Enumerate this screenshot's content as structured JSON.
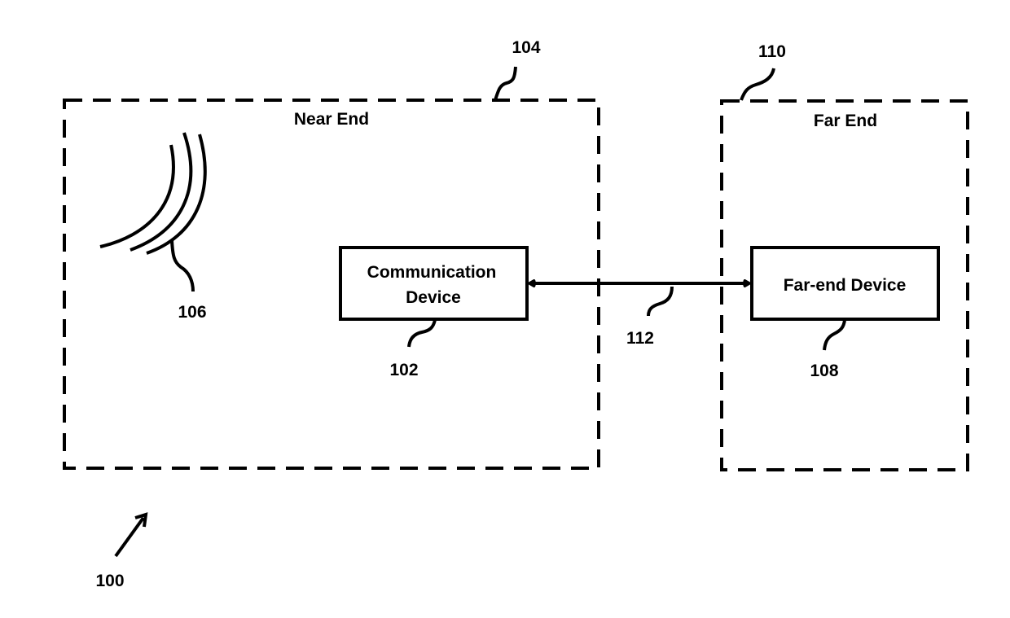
{
  "figure": {
    "reference": "100",
    "stroke_color": "#000000",
    "background": "#ffffff"
  },
  "regions": {
    "near_end": {
      "title": "Near End",
      "ref": "104"
    },
    "far_end": {
      "title": "Far End",
      "ref": "110"
    }
  },
  "components": {
    "sound_source": {
      "ref": "106",
      "icon": "sound-waves-icon"
    },
    "communication_device": {
      "line1": "Communication",
      "line2": "Device",
      "ref": "102"
    },
    "far_end_device": {
      "label": "Far-end Device",
      "ref": "108"
    },
    "link": {
      "ref": "112",
      "type": "bidirectional"
    }
  }
}
